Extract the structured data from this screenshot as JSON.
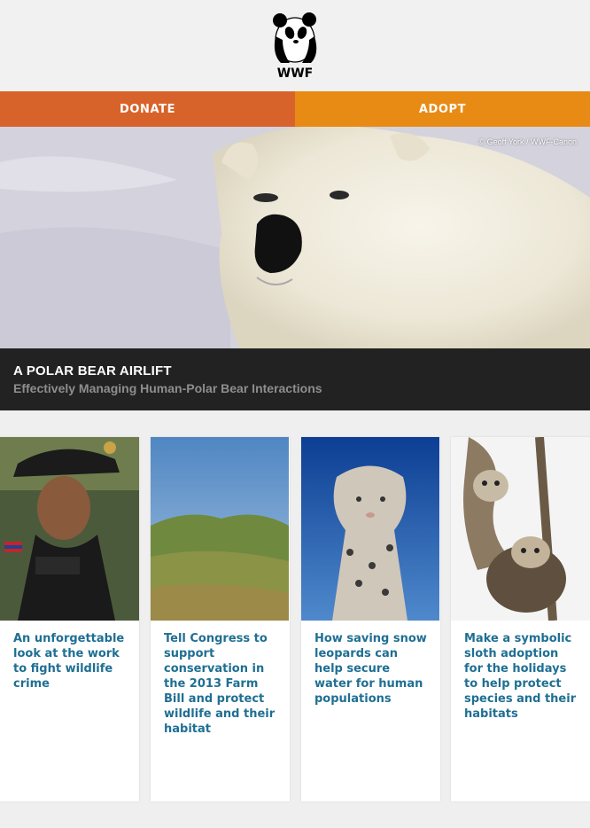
{
  "brand": {
    "logo_text": "WWF"
  },
  "cta": {
    "donate_label": "DONATE",
    "adopt_label": "ADOPT"
  },
  "hero": {
    "credit": "© Geoff York / WWF-Canon",
    "title": "A POLAR BEAR AIRLIFT",
    "subtitle": "Effectively Managing Human-Polar Bear Interactions"
  },
  "cards": [
    {
      "image": "ranger-photo",
      "text": "An unforgettable look at the work to fight wildlife crime"
    },
    {
      "image": "grassland-photo",
      "text": "Tell Congress to support conservation in the 2013 Farm Bill and protect wildlife and their habitat"
    },
    {
      "image": "snow-leopard-photo",
      "text": "How saving snow leopards can help secure water for human populations"
    },
    {
      "image": "sloth-photo",
      "text": "Make a symbolic sloth adoption for the holidays to help protect species and their habitats"
    }
  ]
}
